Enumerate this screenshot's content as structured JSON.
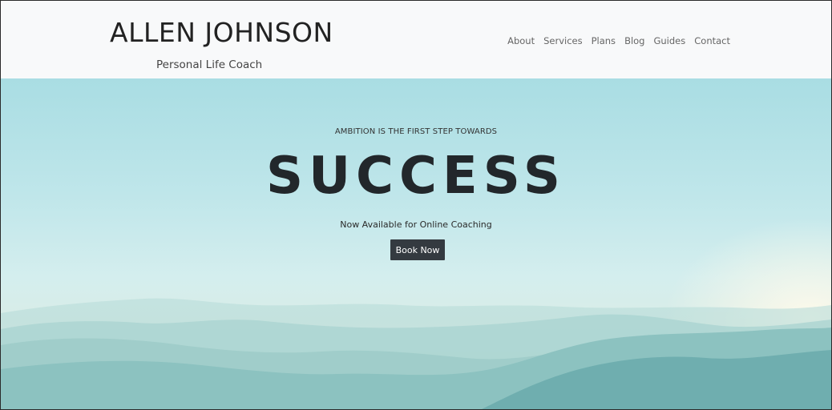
{
  "header": {
    "brand_name": "ALLEN JOHNSON",
    "brand_tagline": "Personal Life Coach",
    "nav": [
      {
        "label": "About"
      },
      {
        "label": "Services"
      },
      {
        "label": "Plans"
      },
      {
        "label": "Blog"
      },
      {
        "label": "Guides"
      },
      {
        "label": "Contact"
      }
    ]
  },
  "hero": {
    "tagline": "AMBITION IS THE FIRST STEP TOWARDS",
    "headline": "SUCCESS",
    "subtext": "Now Available for Online Coaching",
    "cta_label": "Book Now"
  },
  "colors": {
    "header_bg": "#f8f9fa",
    "button_bg": "#343a40",
    "headline": "#22272b",
    "sky": "#a9dde3"
  }
}
